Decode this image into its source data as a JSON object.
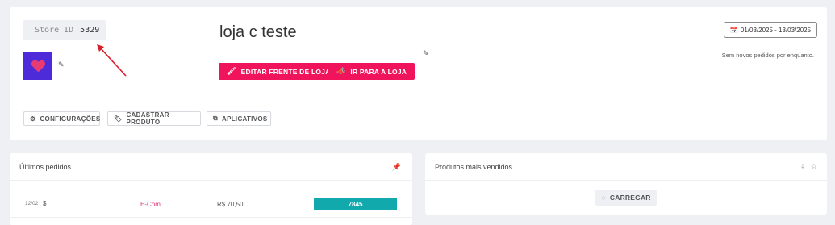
{
  "store": {
    "id_label": "Store ID",
    "id_value": "5329",
    "name": "loja c teste",
    "logo_text": "LOVE"
  },
  "actions": {
    "edit_storefront": "EDITAR FRENTE DE LOJA",
    "go_to_store": "IR PARA A LOJA"
  },
  "date_range": "01/03/2025 - 13/03/2025",
  "no_orders_msg": "Sem novos pedidos por enquanto.",
  "tabs": {
    "settings": "CONFIGURAÇÕES",
    "add_product": "CADASTRAR PRODUTO",
    "apps": "APLICATIVOS"
  },
  "recent_orders": {
    "title": "Últimos pedidos",
    "rows": [
      {
        "date": "12/02",
        "currency_symbol": "$",
        "channel": "E-Com",
        "amount": "R$ 70,50",
        "order_number": "7845"
      }
    ]
  },
  "best_sellers": {
    "title": "Produtos mais vendidos",
    "load_label": "CARREGAR"
  },
  "colors": {
    "primary": "#f0145c",
    "order_badge": "#12a9ad",
    "logo_bg": "#4d2bd8"
  }
}
